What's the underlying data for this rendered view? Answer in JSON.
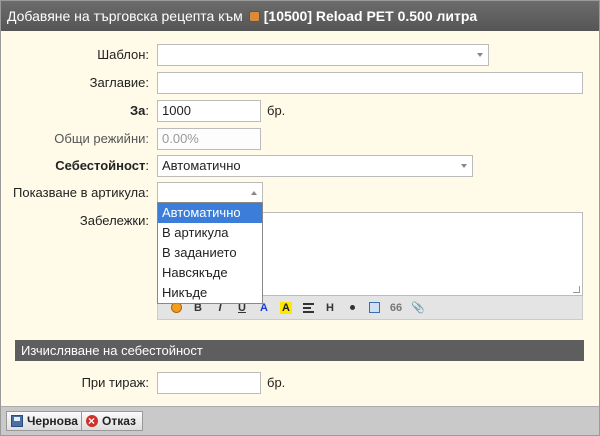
{
  "titlebar": {
    "title": "Добавяне на търговска рецепта към",
    "product": "[10500] Reload PET 0.500 литра",
    "product_icon": "product-icon"
  },
  "form": {
    "template": {
      "label": "Шаблон:",
      "value": ""
    },
    "name": {
      "label": "Заглавие:",
      "value": ""
    },
    "quantity": {
      "label": "За",
      "colon": ":",
      "value": "1000",
      "unit": "бр."
    },
    "overhead": {
      "label": "Общи режийни:",
      "placeholder": "0.00%"
    },
    "cost": {
      "label": "Себестойност",
      "colon": ":",
      "value": "Автоматично"
    },
    "show_in_item": {
      "label": "Показване в артикула:",
      "value": ""
    },
    "notes": {
      "label": "Забележки:"
    }
  },
  "dropdown": {
    "options": [
      "Автоматично",
      "В артикула",
      "В заданието",
      "Навсякъде",
      "Никъде"
    ],
    "selected_index": 0
  },
  "editor_toolbar": {
    "icons": [
      "smiley-icon",
      "bold-icon",
      "italic-icon",
      "underline-icon",
      "font-color-icon",
      "highlight-icon",
      "align-icon",
      "heading-icon",
      "bullet-icon",
      "table-icon",
      "quote-icon",
      "attach-icon"
    ],
    "bold": "B",
    "italic": "I",
    "underline": "U",
    "font_color": "A",
    "highlight": "A",
    "heading": "H",
    "quote": "66"
  },
  "section": {
    "title": "Изчисляване на себестойност"
  },
  "print_run": {
    "label": "При тираж:",
    "value": "",
    "unit": "бр."
  },
  "footer": {
    "save_label": "Чернова",
    "cancel_label": "Отказ"
  },
  "colors": {
    "titlebar": "#5c5c5c",
    "dialog_bg": "#fffbe8",
    "selected_option": "#3b7dd8"
  }
}
